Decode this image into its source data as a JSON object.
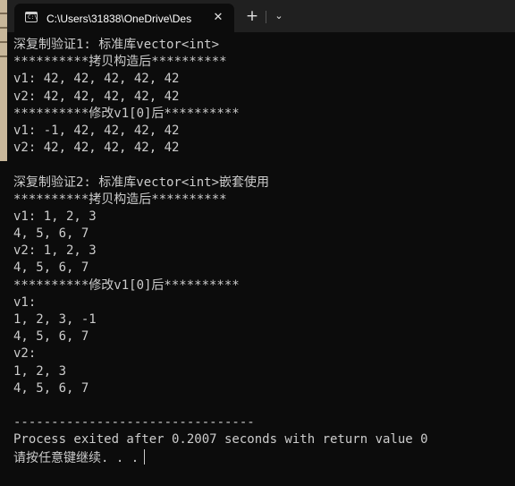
{
  "window": {
    "tab_title": "C:\\Users\\31838\\OneDrive\\Des",
    "tab_icon_glyph": "C:\\",
    "close_glyph": "✕",
    "new_tab_glyph": "+",
    "dropdown_glyph": "⌄"
  },
  "terminal": {
    "lines": [
      "深复制验证1: 标准库vector<int>",
      "**********拷贝构造后**********",
      "v1: 42, 42, 42, 42, 42",
      "v2: 42, 42, 42, 42, 42",
      "**********修改v1[0]后**********",
      "v1: -1, 42, 42, 42, 42",
      "v2: 42, 42, 42, 42, 42",
      "",
      "深复制验证2: 标准库vector<int>嵌套使用",
      "**********拷贝构造后**********",
      "v1: 1, 2, 3",
      "4, 5, 6, 7",
      "v2: 1, 2, 3",
      "4, 5, 6, 7",
      "**********修改v1[0]后**********",
      "v1:",
      "1, 2, 3, -1",
      "4, 5, 6, 7",
      "v2:",
      "1, 2, 3",
      "4, 5, 6, 7",
      "",
      "--------------------------------",
      "Process exited after 0.2007 seconds with return value 0",
      "请按任意键继续. . ."
    ]
  },
  "colors": {
    "background": "#0c0c0c",
    "titlebar": "#202020",
    "text": "#cccccc"
  }
}
